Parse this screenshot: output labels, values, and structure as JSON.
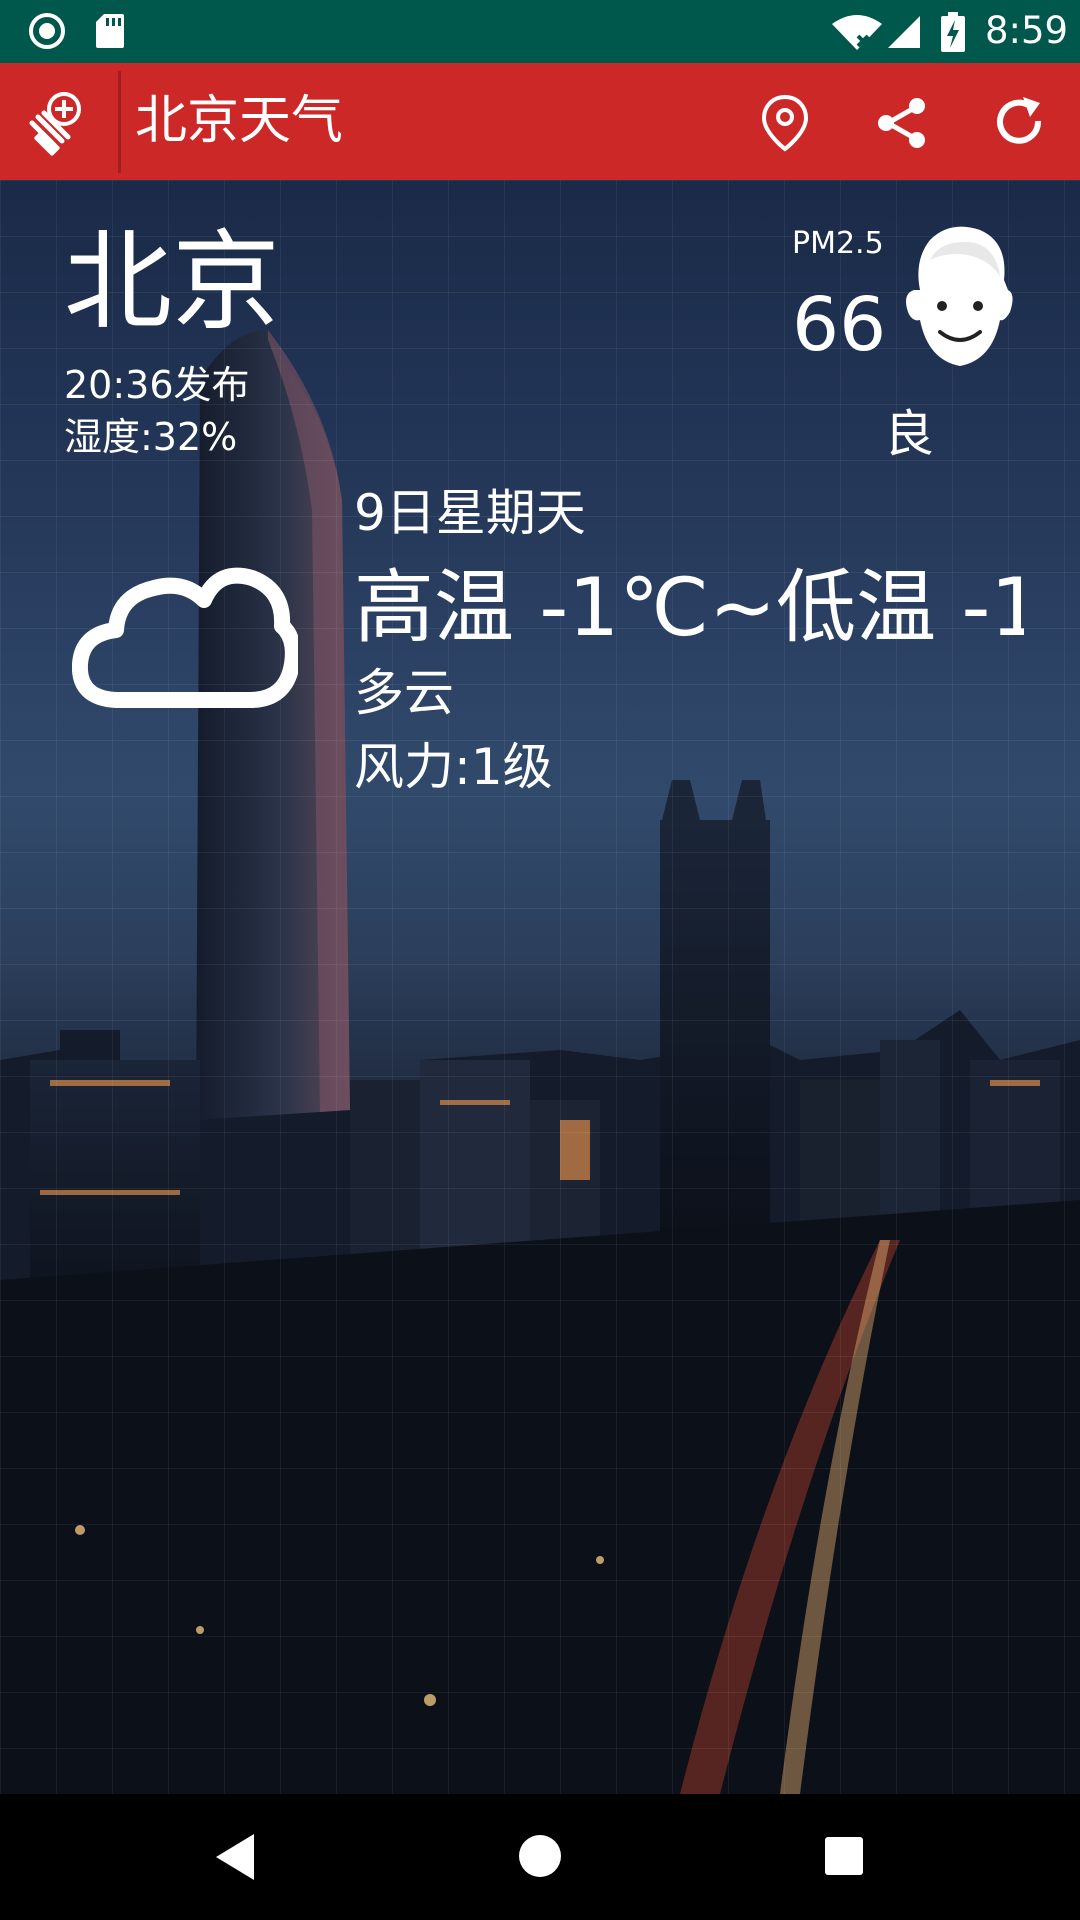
{
  "status_bar": {
    "time": "8:59",
    "left_icons": [
      "record-icon",
      "sd-card-icon"
    ],
    "right_icons": [
      "wifi-icon",
      "signal-icon",
      "battery-charging-icon"
    ]
  },
  "app_bar": {
    "title": "北京天气",
    "nav_icon": "add-city-icon",
    "actions": [
      "location-pin-icon",
      "share-icon",
      "refresh-icon"
    ],
    "color": "#cc2828"
  },
  "weather": {
    "city": "北京",
    "publish_time": "20:36发布",
    "humidity": "湿度:32%",
    "pm_label": "PM2.5",
    "pm_value": "66",
    "air_quality": "良",
    "date": "9日星期天",
    "temperature": "高温 -1℃~低温 -1...",
    "condition": "多云",
    "wind": "风力:1级",
    "icon": "cloud-icon"
  },
  "nav_bar": {
    "buttons": [
      "back-icon",
      "home-icon",
      "recents-icon"
    ]
  },
  "colors": {
    "status_bar": "#00574b",
    "accent": "#cc2828"
  }
}
